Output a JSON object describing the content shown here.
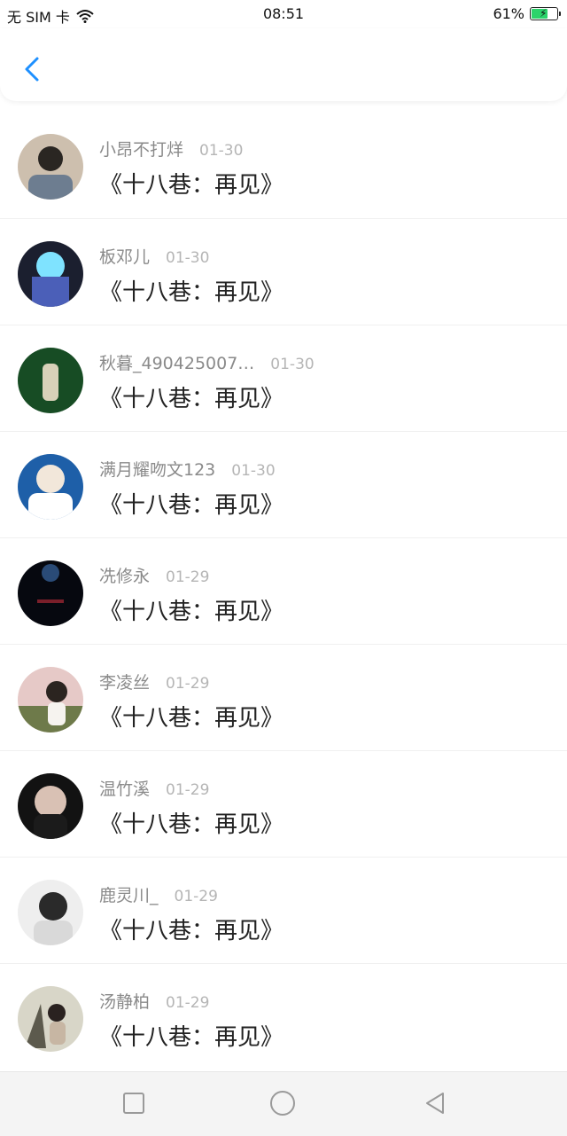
{
  "status_bar": {
    "carrier": "无 SIM 卡",
    "time": "08:51",
    "battery_percent": "61%",
    "battery_level": 0.61
  },
  "header": {
    "back_icon": "chevron-left-icon",
    "accent": "#1e90ff"
  },
  "items": [
    {
      "name": "小昂不打烊",
      "date": "01-30",
      "title": "《十八巷：再见》"
    },
    {
      "name": "板邓儿",
      "date": "01-30",
      "title": "《十八巷：再见》"
    },
    {
      "name": "秋暮_490425007…",
      "date": "01-30",
      "title": "《十八巷：再见》"
    },
    {
      "name": "满月耀吻文123",
      "date": "01-30",
      "title": "《十八巷：再见》"
    },
    {
      "name": "冼修永",
      "date": "01-29",
      "title": "《十八巷：再见》"
    },
    {
      "name": "李凌丝",
      "date": "01-29",
      "title": "《十八巷：再见》"
    },
    {
      "name": "温竹溪",
      "date": "01-29",
      "title": "《十八巷：再见》"
    },
    {
      "name": "鹿灵川_",
      "date": "01-29",
      "title": "《十八巷：再见》"
    },
    {
      "name": "汤静柏",
      "date": "01-29",
      "title": "《十八巷：再见》"
    }
  ],
  "bottom_nav": {
    "icons": [
      "square-icon",
      "circle-icon",
      "triangle-back-icon"
    ]
  }
}
